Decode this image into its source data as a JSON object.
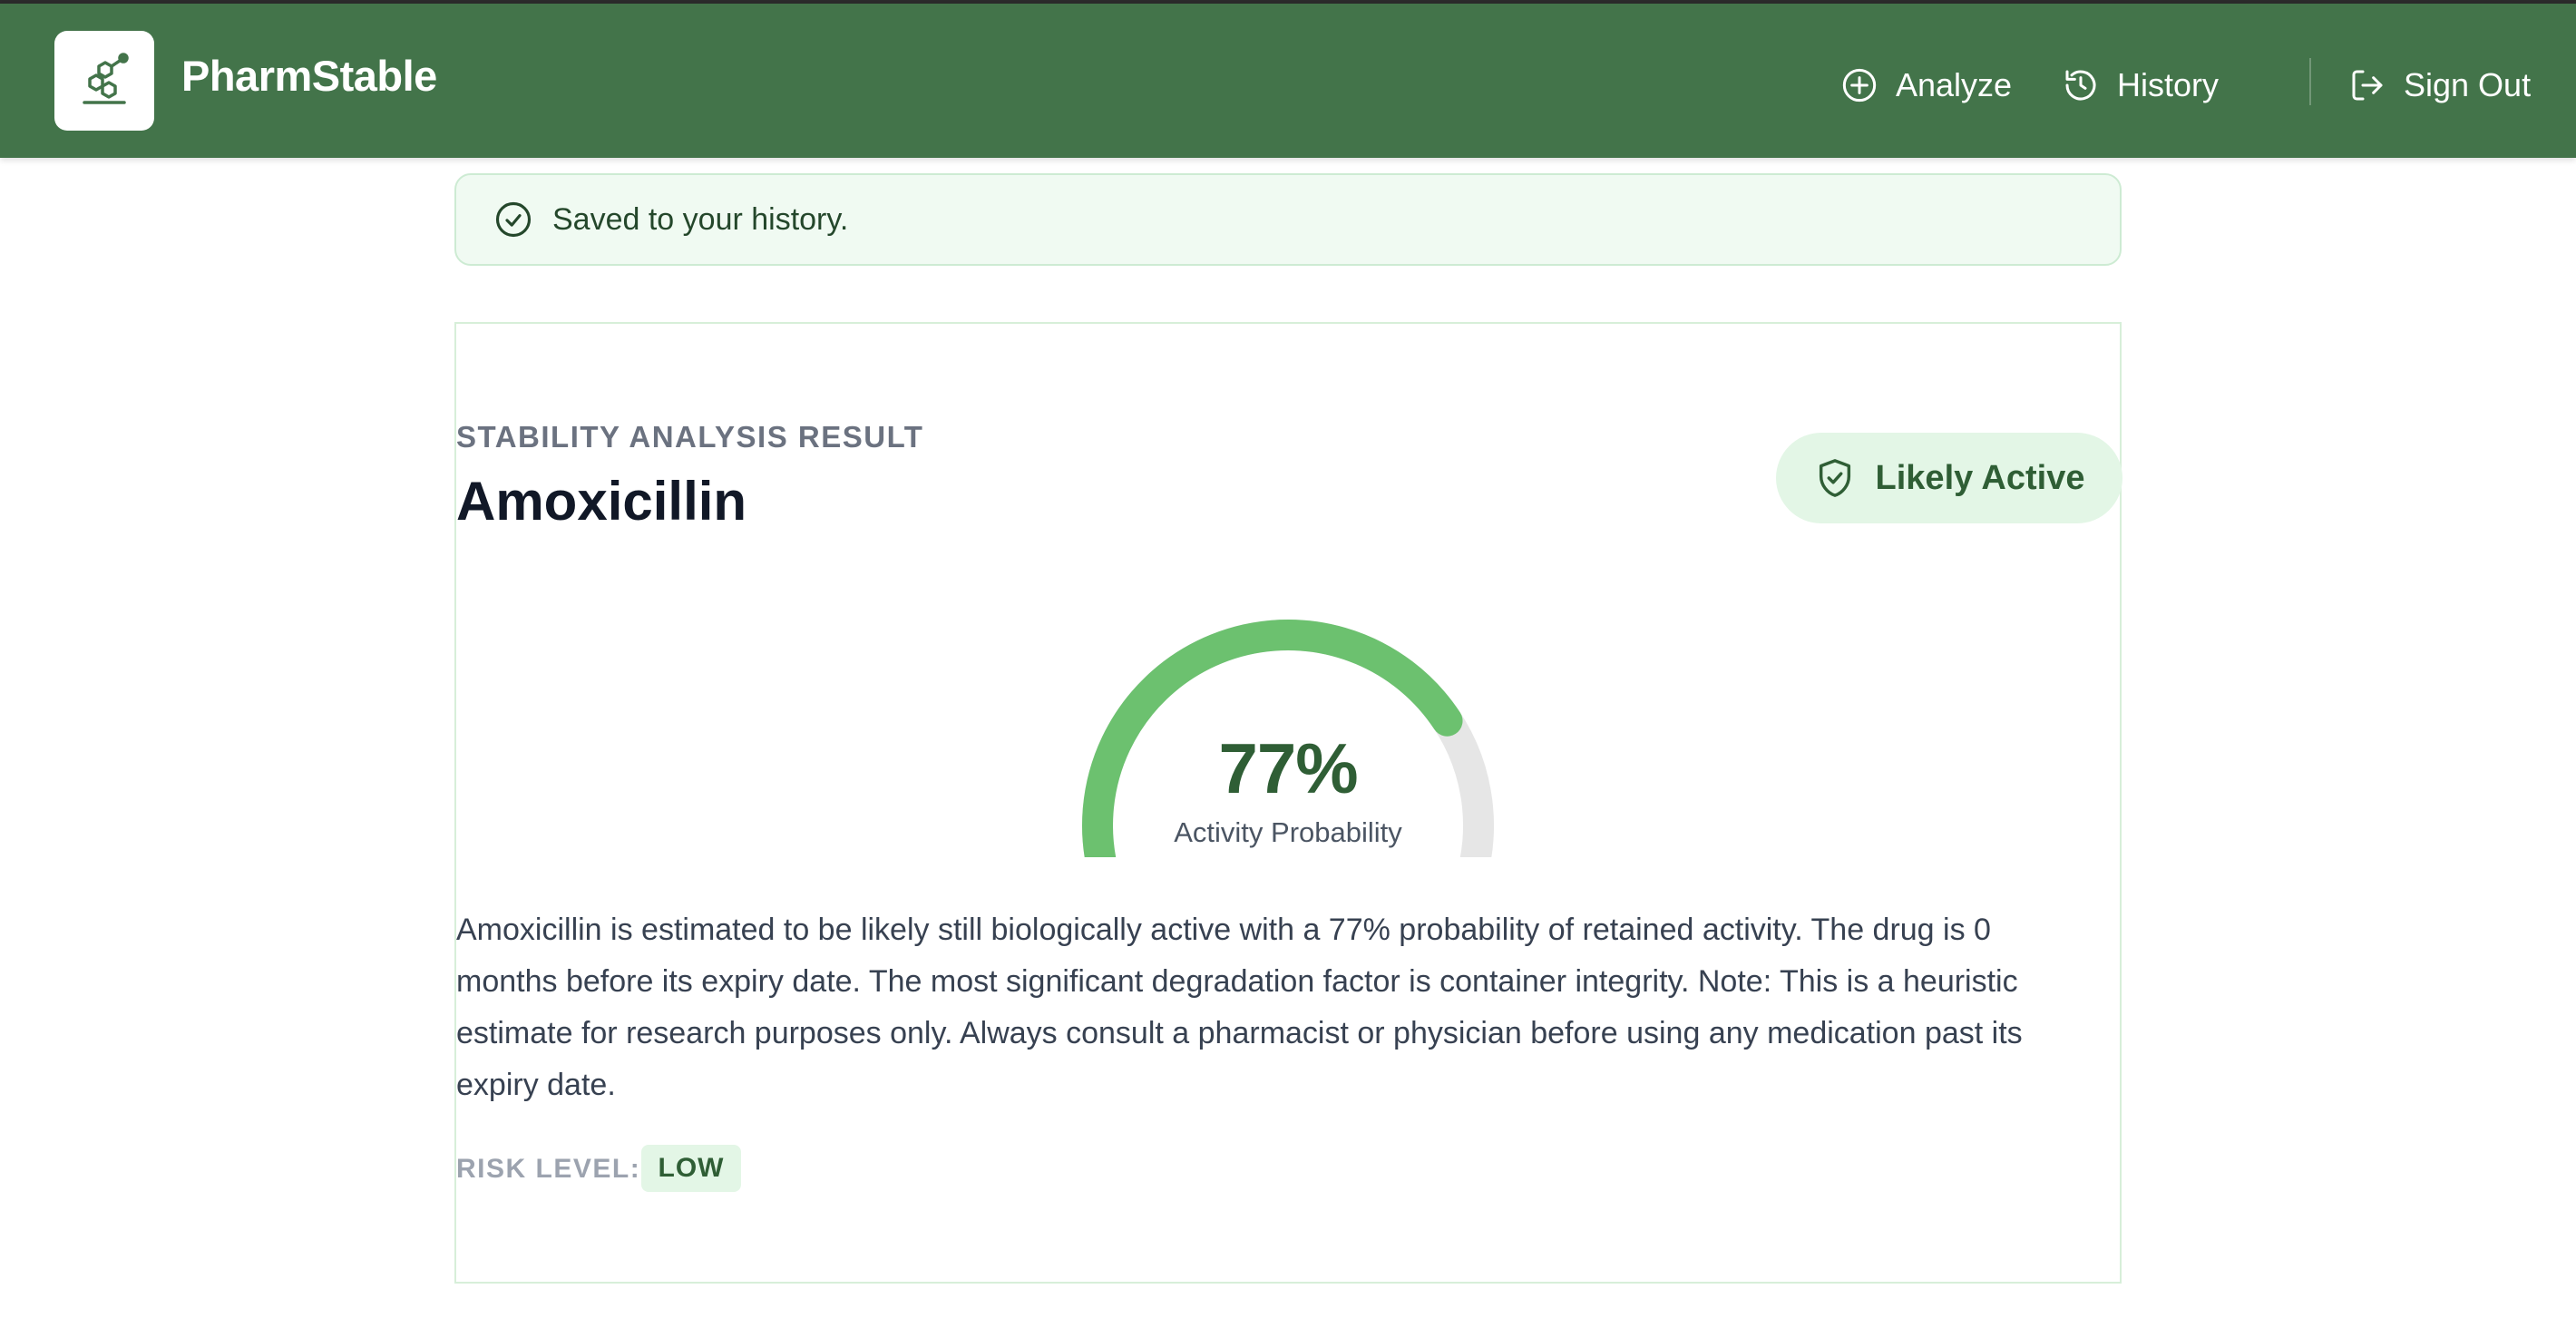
{
  "app": {
    "name": "PharmStable"
  },
  "nav": {
    "analyze": "Analyze",
    "history": "History",
    "sign_out": "Sign Out"
  },
  "alert": {
    "text": "Saved to your history."
  },
  "result": {
    "eyebrow": "STABILITY ANALYSIS RESULT",
    "drug_name": "Amoxicillin",
    "verdict": "Likely Active",
    "gauge": {
      "value_text": "77%",
      "fraction": 0.77,
      "label": "Activity Probability"
    },
    "summary": "Amoxicillin is estimated to be likely still biologically active with a 77% probability of retained activity. The drug is 0 months before its expiry date. The most significant degradation factor is container integrity. Note: This is a heuristic estimate for research purposes only. Always consult a pharmacist or physician before using any medication past its expiry date.",
    "risk_label": "RISK LEVEL:",
    "risk_value": "LOW"
  },
  "icons": {
    "logo": "molecule-icon",
    "analyze": "plus-circle-icon",
    "history": "history-icon",
    "sign_out": "log-out-icon",
    "alert": "check-circle-icon",
    "verdict": "shield-check-icon"
  },
  "colors": {
    "nav_bg": "#43744a",
    "accent": "#6cc16f",
    "track": "#e6e6e6",
    "dark_green": "#2f5e35",
    "badge_bg": "#e3f6e6"
  }
}
